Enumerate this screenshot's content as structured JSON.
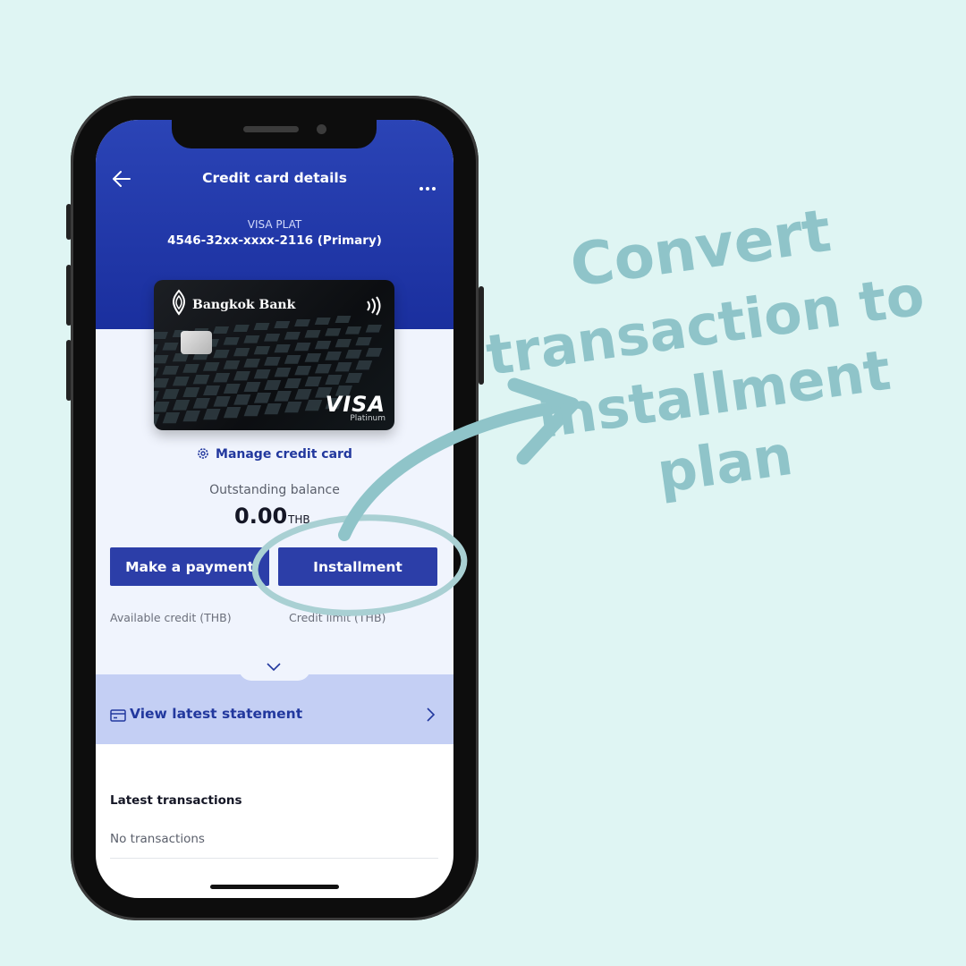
{
  "nav": {
    "title": "Credit card details"
  },
  "card": {
    "type_label": "VISA PLAT",
    "number_label": "4546-32xx-xxxx-2116 (Primary)",
    "bank_name": "Bangkok Bank",
    "brand": "VISA",
    "brand_tier": "Platinum"
  },
  "manage": {
    "label": "Manage credit card"
  },
  "balance": {
    "label": "Outstanding balance",
    "amount": "0.00",
    "currency": "THB"
  },
  "actions": {
    "pay_label": "Make a payment",
    "installment_label": "Installment"
  },
  "credit": {
    "available_label": "Available credit (THB)",
    "limit_label": "Credit limit (THB)"
  },
  "statement": {
    "label": "View latest statement"
  },
  "transactions": {
    "title": "Latest transactions",
    "empty_text": "No transactions"
  },
  "annotation": {
    "lines": [
      "Convert",
      "transaction to",
      "installment",
      "plan"
    ],
    "color": "#8fc4c9"
  },
  "colors": {
    "background": "#dff5f3",
    "header_blue": "#2b44b6",
    "button_blue": "#2c3ea8",
    "statement_bar": "#c4cff4"
  }
}
